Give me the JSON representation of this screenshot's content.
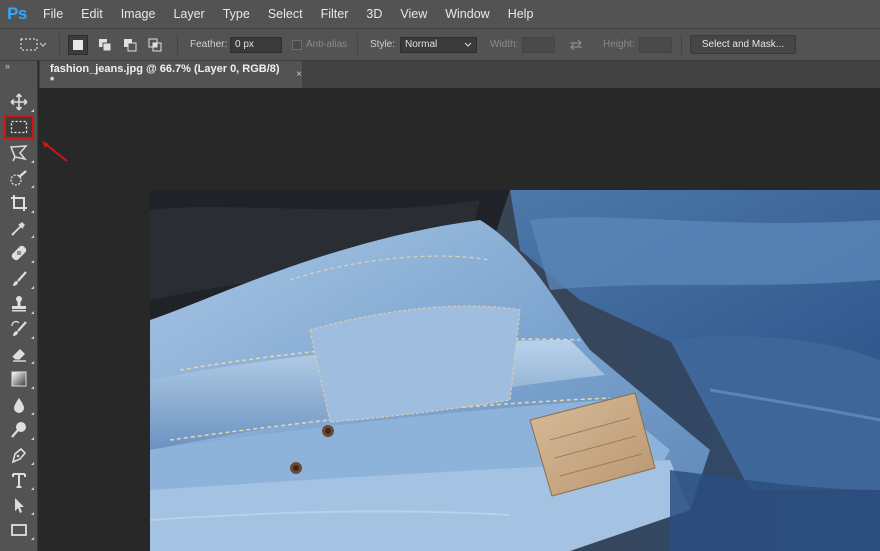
{
  "app": {
    "logo": "Ps"
  },
  "menu": [
    "File",
    "Edit",
    "Image",
    "Layer",
    "Type",
    "Select",
    "Filter",
    "3D",
    "View",
    "Window",
    "Help"
  ],
  "options": {
    "feather_label": "Feather:",
    "feather_value": "0 px",
    "antialias_label": "Anti-alias",
    "style_label": "Style:",
    "style_value": "Normal",
    "width_label": "Width:",
    "height_label": "Height:",
    "select_mask_button": "Select and Mask..."
  },
  "document": {
    "tab_title": "fashion_jeans.jpg @ 66.7% (Layer 0, RGB/8) *",
    "close_glyph": "×"
  },
  "toolbar": {
    "collapse_glyph": "››",
    "tools": [
      "move-tool",
      "rectangular-marquee-tool",
      "lasso-tool",
      "quick-selection-tool",
      "crop-tool",
      "eyedropper-tool",
      "healing-brush-tool",
      "brush-tool",
      "clone-stamp-tool",
      "history-brush-tool",
      "eraser-tool",
      "gradient-tool",
      "blur-tool",
      "dodge-tool",
      "pen-tool",
      "type-tool",
      "path-selection-tool",
      "rectangle-tool"
    ],
    "selected_tool": "rectangular-marquee-tool",
    "highlight_color": "#d01515"
  },
  "colors": {
    "accent_logo": "#31a8ff",
    "panel": "#535353",
    "canvas": "#282828",
    "annotation": "#d01515"
  }
}
